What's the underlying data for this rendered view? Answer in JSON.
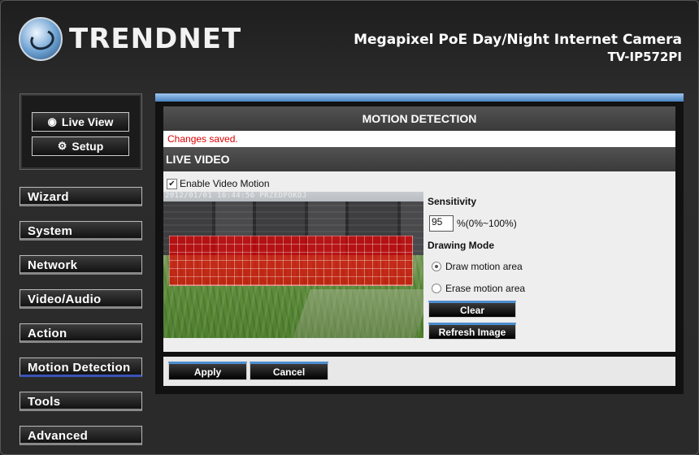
{
  "header": {
    "brand": "TRENDNET",
    "product_line": "Megapixel PoE Day/Night Internet Camera",
    "model": "TV-IP572PI"
  },
  "mode": {
    "live_view": "Live View",
    "setup": "Setup"
  },
  "nav": {
    "items": [
      "Wizard",
      "System",
      "Network",
      "Video/Audio",
      "Action",
      "Motion Detection",
      "Tools",
      "Advanced"
    ],
    "active": "Motion Detection"
  },
  "panel": {
    "title": "MOTION DETECTION",
    "status_message": "Changes saved.",
    "section_title": "LIVE VIDEO",
    "enable_label": "Enable Video Motion",
    "enable_checked": true,
    "video_timestamp": "2012/01/01 16:44:56 PRZEDPOKOJ",
    "sensitivity_label": "Sensitivity",
    "sensitivity_value": "95",
    "sensitivity_range": "%(0%~100%)",
    "drawing_mode_label": "Drawing Mode",
    "draw_option": "Draw motion area",
    "erase_option": "Erase motion area",
    "selected_mode": "Draw motion area",
    "clear_button": "Clear",
    "refresh_button": "Refresh Image",
    "apply_button": "Apply",
    "cancel_button": "Cancel"
  },
  "colors": {
    "accent_blue": "#4c84c0",
    "status_red": "#dd0000",
    "motion_red": "#e10000"
  }
}
